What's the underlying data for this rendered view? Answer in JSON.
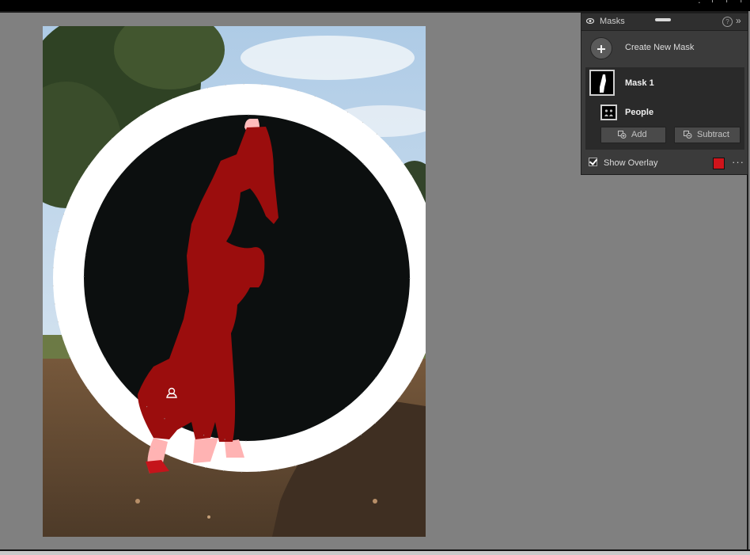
{
  "panel": {
    "title": "Masks",
    "help_glyph": "?",
    "expand_glyph": "»",
    "create_new_mask": "Create New Mask",
    "mask": {
      "name": "Mask 1",
      "component": "People"
    },
    "add_button": "Add",
    "subtract_button": "Subtract",
    "show_overlay_label": "Show Overlay",
    "show_overlay_checked": true,
    "overlay_color": "#d0141b",
    "more_glyph": "···"
  },
  "topbar_glyphs": "· ╵ ╵ ╵",
  "icons": {
    "eye": "eye-icon",
    "add": "plus-icon",
    "people": "people-icon",
    "subtract": "subtract-icon",
    "brush_cursor": "person-brush-icon"
  }
}
